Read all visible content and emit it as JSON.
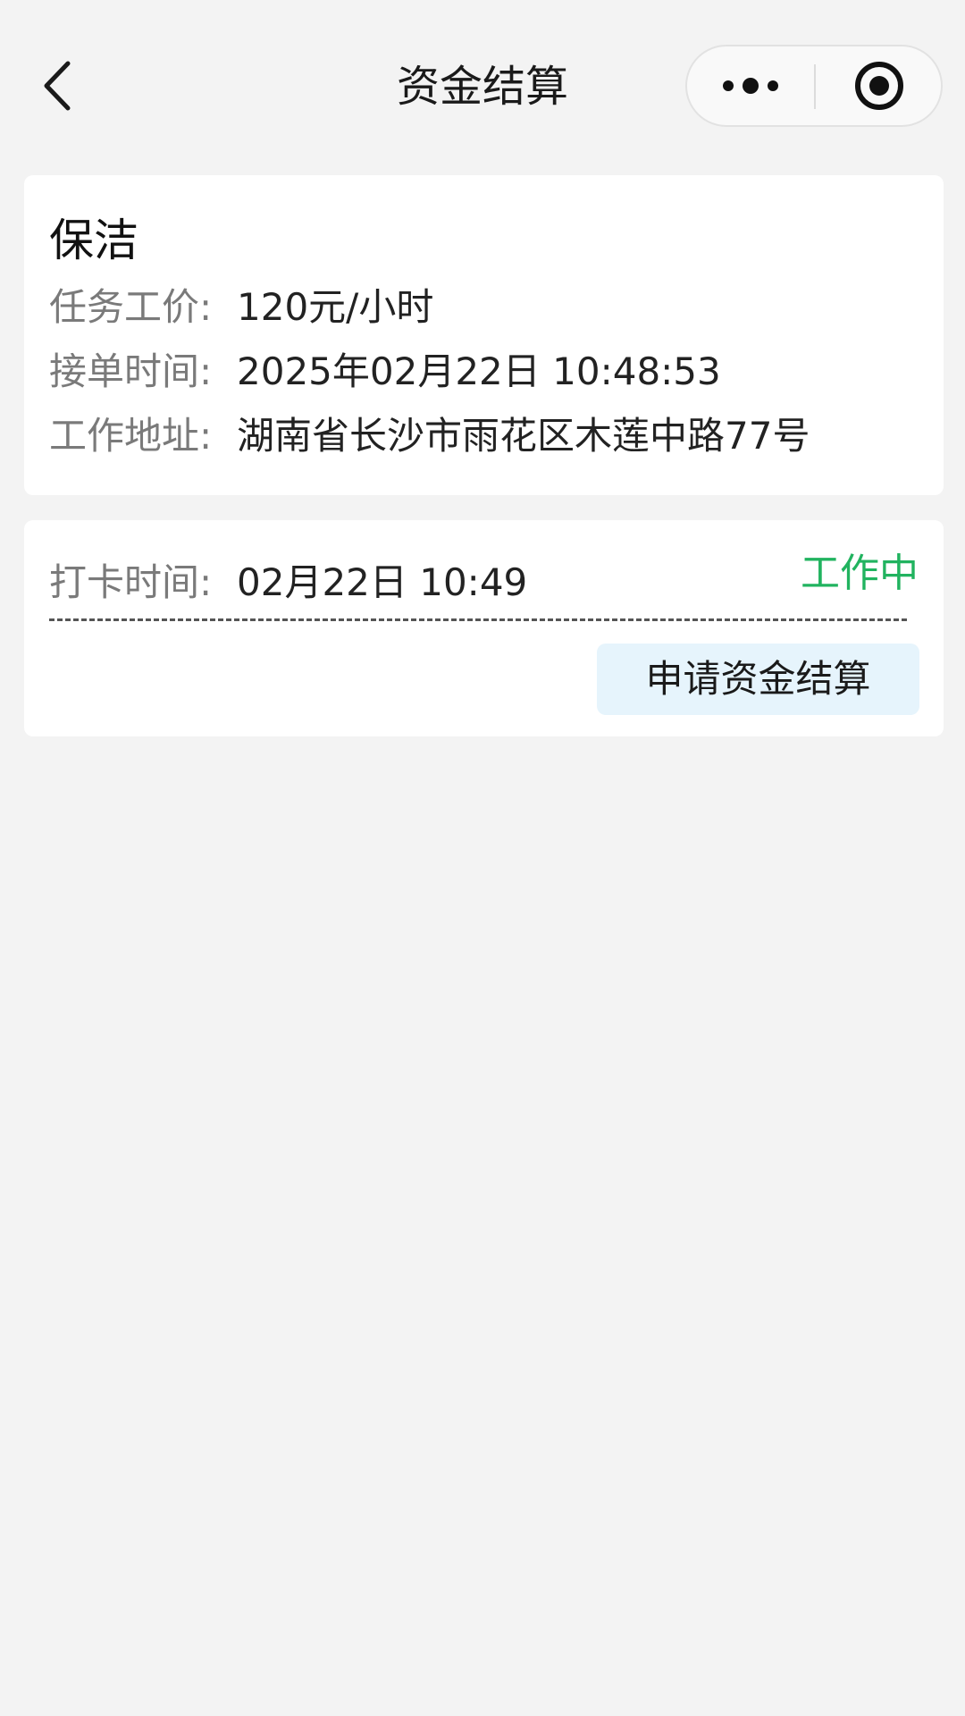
{
  "header": {
    "title": "资金结算",
    "back_icon": "chevron-left-icon",
    "more_icon": "more-dots-icon",
    "close_icon": "target-close-icon"
  },
  "task": {
    "title": "保洁",
    "rows": [
      {
        "label": "任务工价:",
        "value": "120元/小时"
      },
      {
        "label": "接单时间:",
        "value": "2025年02月22日 10:48:53"
      },
      {
        "label": "工作地址:",
        "value": "湖南省长沙市雨花区木莲中路77号"
      }
    ]
  },
  "clock": {
    "label": "打卡时间:",
    "value": "02月22日 10:49",
    "status": "工作中",
    "status_color": "#21b35f",
    "button_label": "申请资金结算",
    "button_color": "#e6f4fc"
  }
}
